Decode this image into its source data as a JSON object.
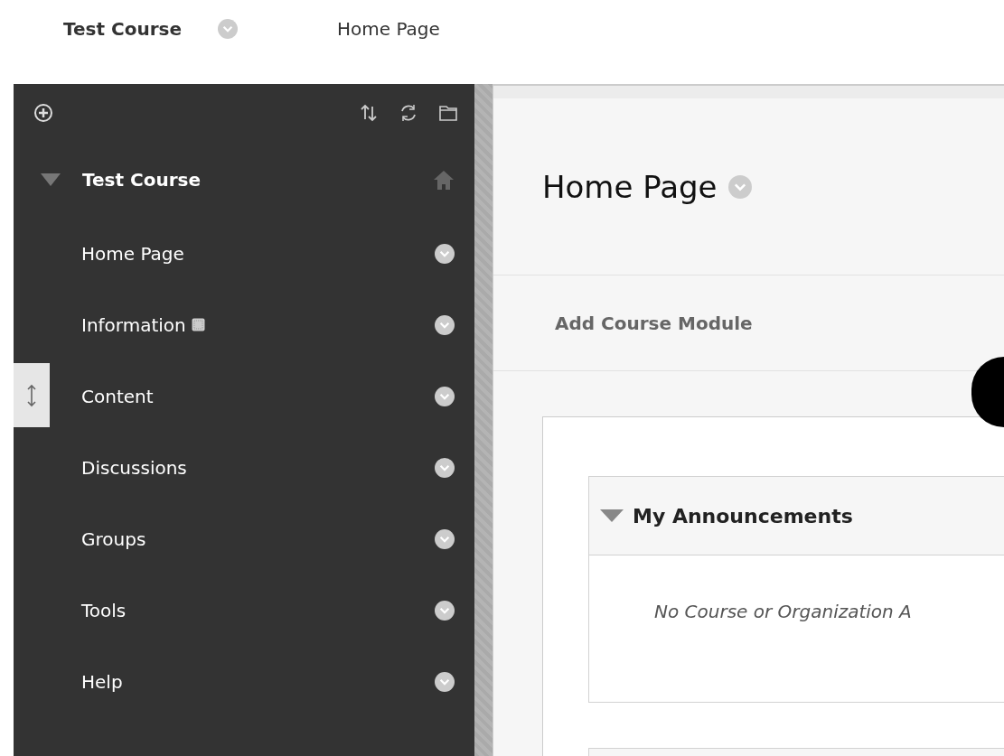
{
  "breadcrumb": {
    "course": "Test Course",
    "page": "Home Page"
  },
  "sidebar": {
    "course_title": "Test Course",
    "expanded": true,
    "items": [
      {
        "label": "Home Page",
        "flagged": false,
        "drag_handle": false
      },
      {
        "label": "Information",
        "flagged": true,
        "drag_handle": false
      },
      {
        "label": "Content",
        "flagged": false,
        "drag_handle": true
      },
      {
        "label": "Discussions",
        "flagged": false,
        "drag_handle": false
      },
      {
        "label": "Groups",
        "flagged": false,
        "drag_handle": false
      },
      {
        "label": "Tools",
        "flagged": false,
        "drag_handle": false
      },
      {
        "label": "Help",
        "flagged": false,
        "drag_handle": false
      }
    ]
  },
  "page": {
    "title": "Home Page",
    "action": "Add Course Module",
    "modules": [
      {
        "title": "My Announcements",
        "expanded": true,
        "message": "No Course or Organization A"
      }
    ]
  }
}
